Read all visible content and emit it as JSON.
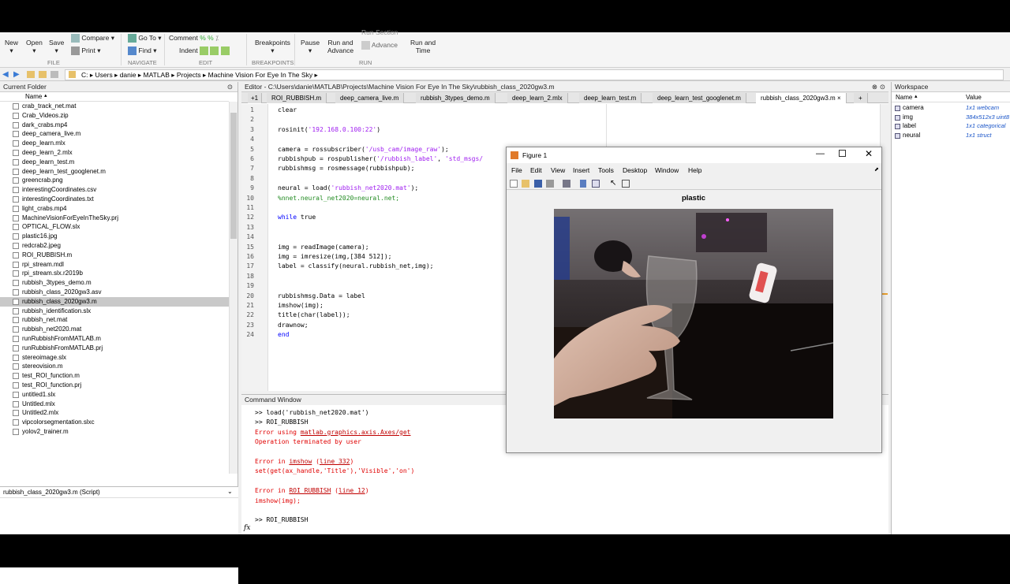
{
  "toolstrip": {
    "file": {
      "new": "New",
      "open": "Open",
      "save": "Save",
      "compare": "Compare",
      "print": "Print",
      "label": "FILE"
    },
    "navigate": {
      "goto": "Go To",
      "find": "Find",
      "label": "NAVIGATE"
    },
    "edit": {
      "comment": "Comment",
      "indent": "Indent",
      "label": "EDIT"
    },
    "breakpoints": {
      "breakpoints": "Breakpoints",
      "label": "BREAKPOINTS"
    },
    "run": {
      "pause": "Pause",
      "run_advance_1": "Run and",
      "run_advance_2": "Advance",
      "run_section": "Run Section",
      "advance": "Advance",
      "run_time_1": "Run and",
      "run_time_2": "Time",
      "label": "RUN"
    }
  },
  "address": {
    "parts": [
      "C:",
      "Users",
      "danie",
      "MATLAB",
      "Projects",
      "Machine Vision For Eye In The Sky"
    ]
  },
  "current_folder": {
    "title": "Current Folder",
    "column": "Name",
    "files": [
      "crab_track_net.mat",
      "Crab_Videos.zip",
      "dark_crabs.mp4",
      "deep_camera_live.m",
      "deep_learn.mlx",
      "deep_learn_2.mlx",
      "deep_learn_test.m",
      "deep_learn_test_googlenet.m",
      "greencrab.png",
      "interestingCoordinates.csv",
      "interestingCoordinates.txt",
      "light_crabs.mp4",
      "MachineVisionForEyeInTheSky.prj",
      "OPTICAL_FLOW.slx",
      "plastic16.jpg",
      "redcrab2.jpeg",
      "ROI_RUBBISH.m",
      "rpi_stream.mdl",
      "rpi_stream.slx.r2019b",
      "rubbish_3types_demo.m",
      "rubbish_class_2020gw3.asv",
      "rubbish_class_2020gw3.m",
      "rubbish_identification.slx",
      "rubbish_net.mat",
      "rubbish_net2020.mat",
      "runRubbishFromMATLAB.m",
      "runRubbishFromMATLAB.prj",
      "stereoimage.slx",
      "stereovision.m",
      "test_ROI_function.m",
      "test_ROI_function.prj",
      "untitled1.slx",
      "Untitled.mlx",
      "Untitled2.mlx",
      "vipcolorsegmentation.slxc",
      "yolov2_trainer.m"
    ],
    "selected_index": 21,
    "details": "rubbish_class_2020gw3.m  (Script)"
  },
  "editor": {
    "title": "Editor - C:\\Users\\danie\\MATLAB\\Projects\\Machine Vision For Eye In The Sky\\rubbish_class_2020gw3.m",
    "tabs": [
      "ROI_RUBBISH.m",
      "deep_camera_live.m",
      "rubbish_3types_demo.m",
      "deep_learn_2.mlx",
      "deep_learn_test.m",
      "deep_learn_test_googlenet.m",
      "rubbish_class_2020gw3.m"
    ],
    "active_tab": 6,
    "lines": [
      {
        "n": "1",
        "t": "clear"
      },
      {
        "n": "2",
        "t": ""
      },
      {
        "n": "3",
        "t": "rosinit('192.168.0.100:22')"
      },
      {
        "n": "4",
        "t": ""
      },
      {
        "n": "5",
        "t": "camera = rossubscriber('/usb_cam/image_raw');"
      },
      {
        "n": "6",
        "t": "rubbishpub = rospublisher('/rubbish_label', 'std_msgs/"
      },
      {
        "n": "7",
        "t": "rubbishmsg = rosmessage(rubbishpub);"
      },
      {
        "n": "8",
        "t": ""
      },
      {
        "n": "9",
        "t": "neural = load('rubbish_net2020.mat');"
      },
      {
        "n": "10",
        "t": "%nnet.neural_net2020=neural.net;"
      },
      {
        "n": "11",
        "t": ""
      },
      {
        "n": "12",
        "t": "while true"
      },
      {
        "n": "13",
        "t": ""
      },
      {
        "n": "14",
        "t": ""
      },
      {
        "n": "15",
        "t": "img = readImage(camera);"
      },
      {
        "n": "16",
        "t": "img = imresize(img,[384 512]);"
      },
      {
        "n": "17",
        "t": "label = classify(neural.rubbish_net,img);"
      },
      {
        "n": "18",
        "t": ""
      },
      {
        "n": "19",
        "t": ""
      },
      {
        "n": "20",
        "t": "rubbishmsg.Data = label"
      },
      {
        "n": "21",
        "t": "imshow(img);"
      },
      {
        "n": "22",
        "t": "title(char(label));"
      },
      {
        "n": "23",
        "t": "drawnow;"
      },
      {
        "n": "24",
        "t": "end"
      }
    ]
  },
  "command_window": {
    "title": "Command Window",
    "lines": [
      {
        "t": ">> load('rubbish_net2020.mat')",
        "c": "norm"
      },
      {
        "t": ">> ROI_RUBBISH",
        "c": "norm"
      },
      {
        "t": "Error using matlab.graphics.axis.Axes/get",
        "c": "err"
      },
      {
        "t": "Operation terminated by user",
        "c": "err"
      },
      {
        "t": "",
        "c": "norm"
      },
      {
        "t": "Error in imshow (line 332)",
        "c": "err"
      },
      {
        "t": "set(get(ax_handle,'Title'),'Visible','on')",
        "c": "err"
      },
      {
        "t": "",
        "c": "norm"
      },
      {
        "t": "Error in ROI_RUBBISH (line 12)",
        "c": "err"
      },
      {
        "t": "imshow(img);",
        "c": "err"
      },
      {
        "t": "",
        "c": "norm"
      },
      {
        "t": ">> ROI_RUBBISH",
        "c": "norm"
      }
    ],
    "prompt": "fx"
  },
  "workspace": {
    "title": "Workspace",
    "col_name": "Name",
    "col_value": "Value",
    "vars": [
      {
        "name": "camera",
        "value": "1x1 webcam"
      },
      {
        "name": "img",
        "value": "384x512x3 uint8"
      },
      {
        "name": "label",
        "value": "1x1 categorical"
      },
      {
        "name": "neural",
        "value": "1x1 struct"
      }
    ]
  },
  "figure": {
    "window_title": "Figure 1",
    "menu": [
      "File",
      "Edit",
      "View",
      "Insert",
      "Tools",
      "Desktop",
      "Window",
      "Help"
    ],
    "axes_title": "plastic"
  }
}
